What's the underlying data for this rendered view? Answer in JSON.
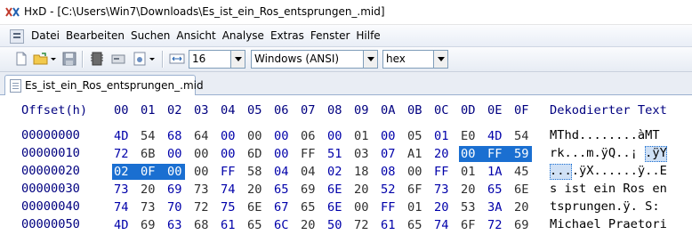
{
  "window": {
    "title": "HxD - [C:\\Users\\Win7\\Downloads\\Es_ist_ein_Ros_entsprungen_.mid]"
  },
  "menu": [
    "Datei",
    "Bearbeiten",
    "Suchen",
    "Ansicht",
    "Analyse",
    "Extras",
    "Fenster",
    "Hilfe"
  ],
  "toolbar": {
    "bytes_per_row": "16",
    "charset": "Windows (ANSI)",
    "offset_base": "hex"
  },
  "tab": {
    "label": "Es_ist_ein_Ros_entsprungen_.mid"
  },
  "editor": {
    "offset_header": "Offset(h)",
    "columns": [
      "00",
      "01",
      "02",
      "03",
      "04",
      "05",
      "06",
      "07",
      "08",
      "09",
      "0A",
      "0B",
      "0C",
      "0D",
      "0E",
      "0F"
    ],
    "text_header": "Dekodierter Text",
    "rows": [
      {
        "offset": "00000000",
        "bytes": [
          "4D",
          "54",
          "68",
          "64",
          "00",
          "00",
          "00",
          "06",
          "00",
          "01",
          "00",
          "05",
          "01",
          "E0",
          "4D",
          "54"
        ],
        "text": "MThd........àMT"
      },
      {
        "offset": "00000010",
        "bytes": [
          "72",
          "6B",
          "00",
          "00",
          "00",
          "6D",
          "00",
          "FF",
          "51",
          "03",
          "07",
          "A1",
          "20",
          "00",
          "FF",
          "59"
        ],
        "text": "rk...m.ÿQ..¡ .ÿY"
      },
      {
        "offset": "00000020",
        "bytes": [
          "02",
          "0F",
          "00",
          "00",
          "FF",
          "58",
          "04",
          "04",
          "02",
          "18",
          "08",
          "00",
          "FF",
          "01",
          "1A",
          "45"
        ],
        "text": "....ÿX......ÿ..E"
      },
      {
        "offset": "00000030",
        "bytes": [
          "73",
          "20",
          "69",
          "73",
          "74",
          "20",
          "65",
          "69",
          "6E",
          "20",
          "52",
          "6F",
          "73",
          "20",
          "65",
          "6E"
        ],
        "text": "s ist ein Ros en"
      },
      {
        "offset": "00000040",
        "bytes": [
          "74",
          "73",
          "70",
          "72",
          "75",
          "6E",
          "67",
          "65",
          "6E",
          "00",
          "FF",
          "01",
          "20",
          "53",
          "3A",
          "20"
        ],
        "text": "tsprungen.ÿ. S: "
      },
      {
        "offset": "00000050",
        "bytes": [
          "4D",
          "69",
          "63",
          "68",
          "61",
          "65",
          "6C",
          "20",
          "50",
          "72",
          "61",
          "65",
          "74",
          "6F",
          "72",
          "69"
        ],
        "text": "Michael Praetori"
      }
    ]
  },
  "colors": {
    "selection": "#1a6fd1",
    "header_text": "#000080"
  }
}
